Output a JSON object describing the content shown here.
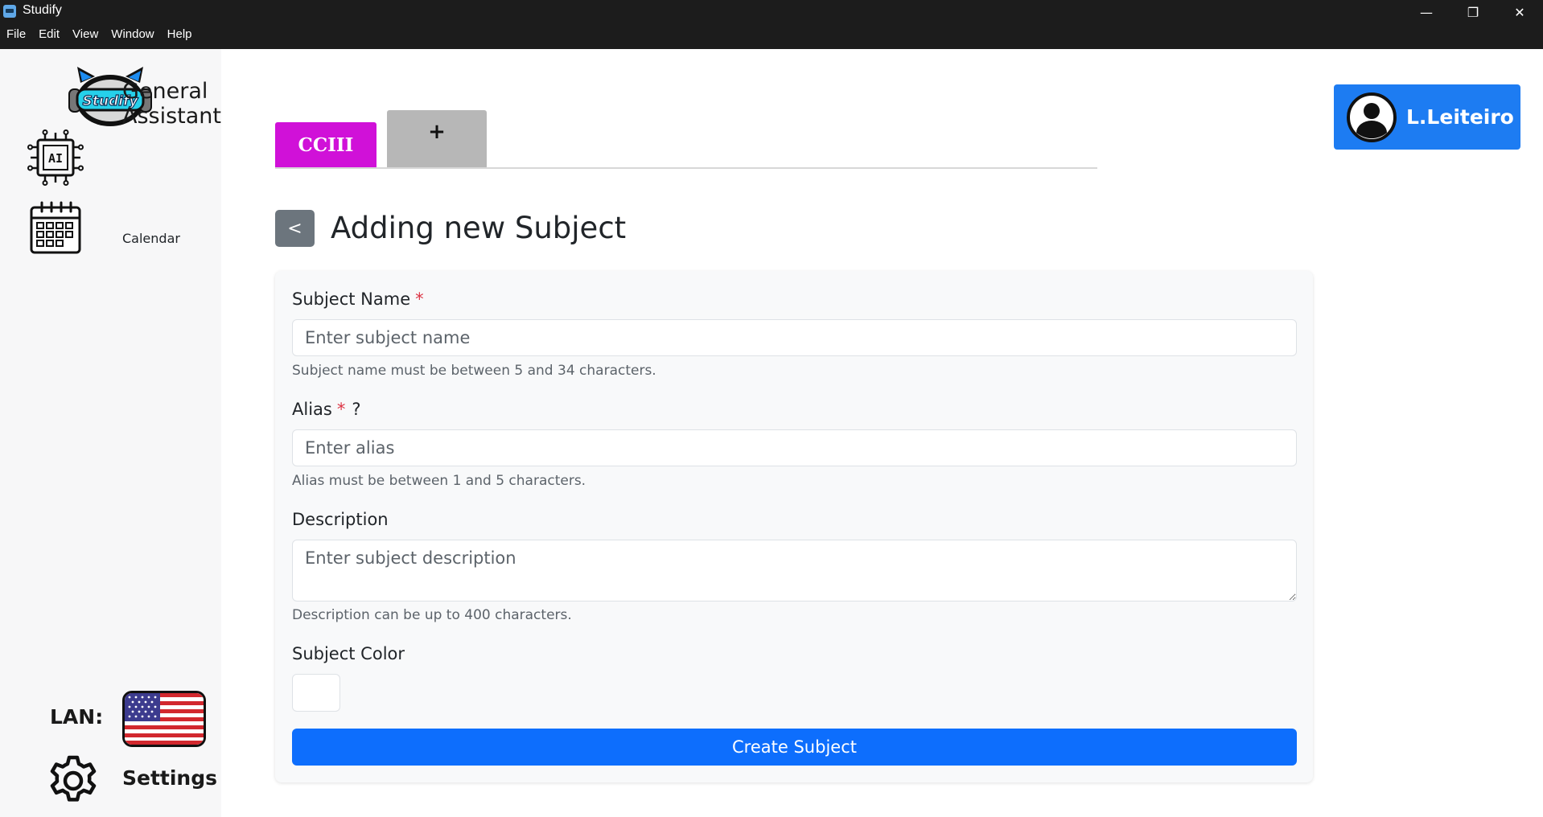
{
  "window": {
    "title": "Studify",
    "menu": [
      "File",
      "Edit",
      "View",
      "Window",
      "Help"
    ],
    "controls": {
      "minimize": "—",
      "restore": "❐",
      "close": "✕"
    }
  },
  "sidebar": {
    "logo_text": "Studify",
    "items": [
      {
        "label_line1": "General",
        "label_line2": "Assistant",
        "icon": "ai-chip-icon"
      },
      {
        "label_line1": "Calendar",
        "icon": "calendar-icon"
      }
    ],
    "language_label": "LAN:",
    "language_flag": "us-flag-icon",
    "settings_label": "Settings"
  },
  "tabs": {
    "items": [
      {
        "label": "CCIII",
        "color": "#d011d8"
      }
    ],
    "add_label": "+"
  },
  "user": {
    "name": "L.Leiteiro"
  },
  "page": {
    "back_label": "<",
    "title": "Adding new Subject"
  },
  "form": {
    "subject_name": {
      "label": "Subject Name",
      "required_mark": "*",
      "placeholder": "Enter subject name",
      "value": "",
      "hint": "Subject name must be between 5 and 34 characters."
    },
    "alias": {
      "label": "Alias",
      "required_mark": "*",
      "help_mark": "?",
      "placeholder": "Enter alias",
      "value": "",
      "hint": "Alias must be between 1 and 5 characters."
    },
    "description": {
      "label": "Description",
      "placeholder": "Enter subject description",
      "value": "",
      "hint": "Description can be up to 400 characters."
    },
    "color": {
      "label": "Subject Color",
      "value": "#ffffff"
    },
    "submit_label": "Create Subject"
  },
  "colors": {
    "primary": "#0d6efd",
    "user_badge": "#1d7cf2",
    "required": "#dc3545",
    "tab_active": "#d011d8",
    "tab_add": "#b7b7b7"
  }
}
